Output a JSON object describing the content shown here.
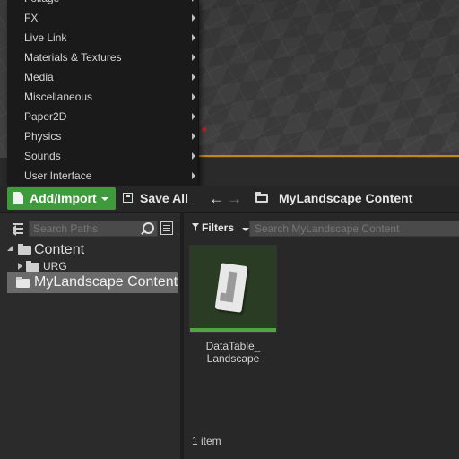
{
  "menu": {
    "items": [
      {
        "label": "Foliage"
      },
      {
        "label": "FX"
      },
      {
        "label": "Live Link"
      },
      {
        "label": "Materials & Textures"
      },
      {
        "label": "Media"
      },
      {
        "label": "Miscellaneous"
      },
      {
        "label": "Paper2D"
      },
      {
        "label": "Physics"
      },
      {
        "label": "Sounds"
      },
      {
        "label": "User Interface"
      }
    ]
  },
  "toolbar": {
    "add_import_label": "Add/Import",
    "save_all_label": "Save All",
    "back_label": "←",
    "forward_label": "→",
    "breadcrumb_label": "MyLandscape Content"
  },
  "sources": {
    "search_placeholder": "Search Paths",
    "tree": [
      {
        "label": "Content",
        "expanded": true
      },
      {
        "label": "URG",
        "expanded": false
      },
      {
        "label": "MyLandscape Content",
        "selected": true
      }
    ]
  },
  "content": {
    "filters_label": "Filters",
    "search_placeholder": "Search MyLandscape Content",
    "asset_name_line1": "DataTable_",
    "asset_name_line2": "Landscape",
    "item_count": "1 item"
  },
  "colors": {
    "accent_green": "#3f9a3b",
    "asset_bar": "#4caa3c",
    "selection": "#6a6a6a"
  }
}
